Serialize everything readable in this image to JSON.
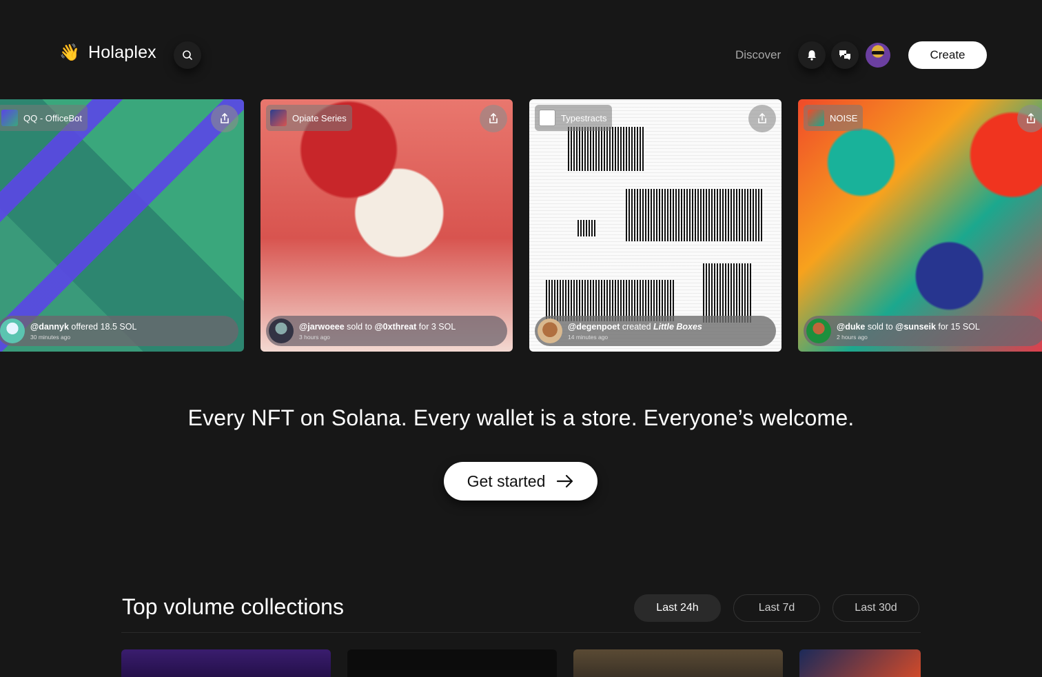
{
  "header": {
    "brand": "Holaplex",
    "nav_discover": "Discover",
    "create_label": "Create"
  },
  "cards": [
    {
      "collection": "QQ - OfficeBot",
      "user": "@dannyk",
      "action": " offered 18.5 SOL",
      "time": "30 minutes ago"
    },
    {
      "collection": "Opiate Series",
      "user": "@jarwoeee",
      "action": " sold to ",
      "target": "@0xthreat",
      "suffix": " for 3 SOL",
      "time": "3 hours ago"
    },
    {
      "collection": "Typestracts",
      "user": "@degenpoet",
      "action": " created ",
      "item": "Little Boxes",
      "time": "14 minutes ago"
    },
    {
      "collection": "NOISE",
      "user": "@duke",
      "action": " sold to ",
      "target": "@sunseik",
      "suffix": " for 15 SOL",
      "time": "2 hours ago"
    }
  ],
  "hero": {
    "tagline": "Every NFT on Solana. Every wallet is a store. Everyone’s welcome.",
    "cta": "Get started"
  },
  "collections_section": {
    "title": "Top volume collections",
    "periods": [
      "Last 24h",
      "Last 7d",
      "Last 30d"
    ],
    "active_period": "Last 24h"
  }
}
